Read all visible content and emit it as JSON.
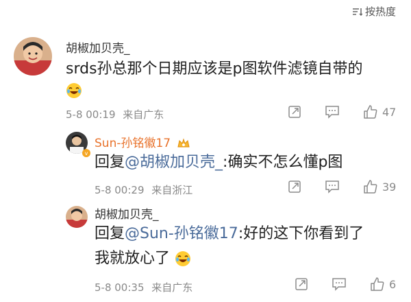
{
  "sort": {
    "label": "按热度"
  },
  "comments": [
    {
      "author": "胡椒加贝壳_",
      "text": "srds孙总那个日期应该是p图软件滤镜自带的",
      "emoji": "laugh-cry",
      "date": "5-8 00:19",
      "location": "来自广东",
      "likes": "47",
      "replies": [
        {
          "author": "Sun-孙铭徽17",
          "prefix": "回复",
          "mention": "@胡椒加贝壳_",
          "text": ":确实不怎么懂p图",
          "date": "5-8 00:29",
          "location": "来自浙江",
          "likes": "39"
        },
        {
          "author": "胡椒加贝壳_",
          "prefix": "回复",
          "mention": "@Sun-孙铭徽17",
          "text_line1": ":好的这下你看到了",
          "text_line2": "我就放心了",
          "emoji": "laugh-cry",
          "date": "5-8 00:35",
          "location": "来自广东",
          "likes": "6"
        }
      ]
    }
  ],
  "colors": {
    "accent_name": "#e8722b",
    "mention": "#4a6b9a",
    "meta": "#888888"
  }
}
